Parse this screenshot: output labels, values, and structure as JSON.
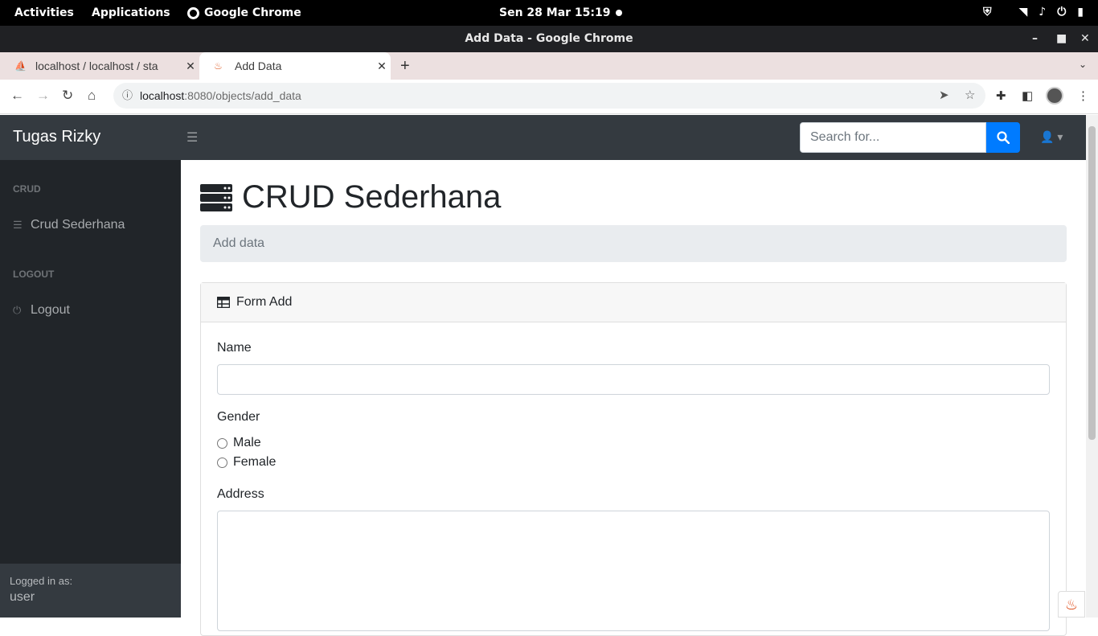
{
  "os": {
    "activities": "Activities",
    "applications": "Applications",
    "app_name": "Google Chrome",
    "clock": "Sen 28 Mar  15:19"
  },
  "window": {
    "title": "Add Data - Google Chrome"
  },
  "browser": {
    "tabs": [
      {
        "label": "localhost / localhost / sta",
        "favicon": "phpmyadmin-icon"
      },
      {
        "label": "Add Data",
        "favicon": "codeigniter-flame-icon"
      }
    ],
    "url_host": "localhost",
    "url_path": ":8080/objects/add_data"
  },
  "app": {
    "brand": "Tugas Rizky",
    "search_placeholder": "Search for...",
    "sidebar": {
      "sections": [
        {
          "heading": "CRUD",
          "item": "Crud Sederhana",
          "icon": "table-icon"
        },
        {
          "heading": "LOGOUT",
          "item": "Logout",
          "icon": "power-icon"
        }
      ],
      "footer_label": "Logged in as:",
      "footer_user": "user"
    },
    "page_title": "CRUD Sederhana",
    "breadcrumb": "Add data",
    "card_title": "Form Add",
    "form": {
      "name_label": "Name",
      "gender_label": "Gender",
      "gender_options": [
        "Male",
        "Female"
      ],
      "address_label": "Address"
    }
  },
  "colors": {
    "navbar": "#343a40",
    "sidebar": "#212529",
    "primary": "#007bff"
  }
}
